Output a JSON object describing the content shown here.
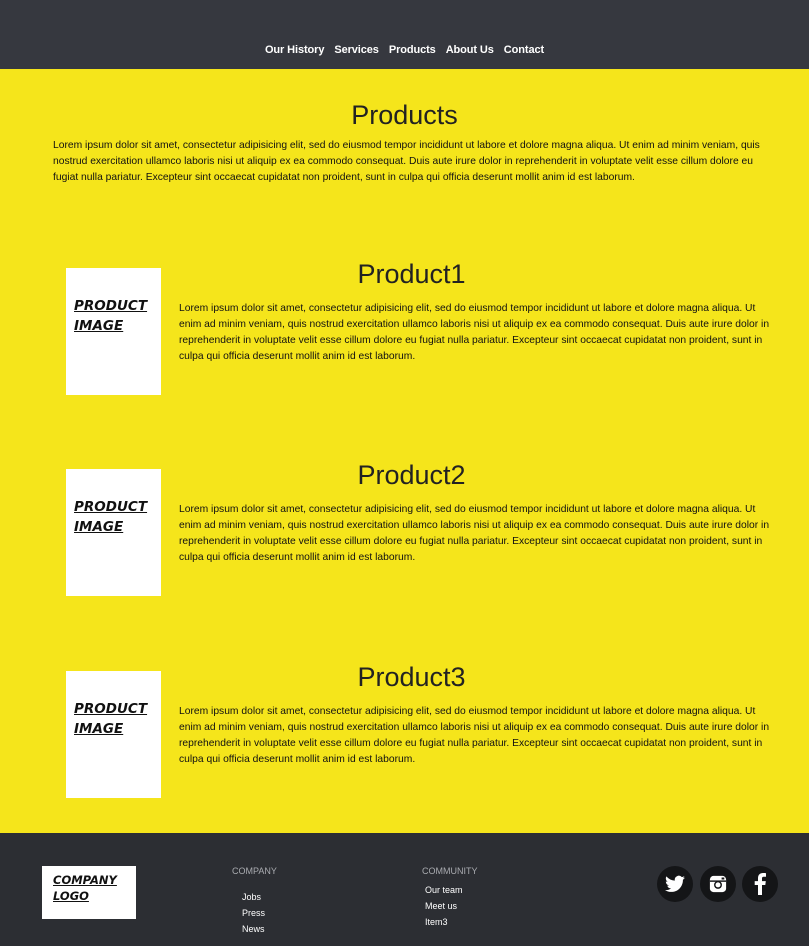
{
  "nav": {
    "items": [
      "Our History",
      "Services",
      "Products",
      "About Us",
      "Contact"
    ]
  },
  "main": {
    "title": "Products",
    "intro": "Lorem ipsum dolor sit amet, consectetur adipisicing elit, sed do eiusmod tempor incididunt ut labore et dolore magna aliqua. Ut enim ad minim veniam, quis nostrud exercitation ullamco laboris nisi ut aliquip ex ea commodo consequat. Duis aute irure dolor in reprehenderit in voluptate velit esse cillum dolore eu fugiat nulla pariatur. Excepteur sint occaecat cupidatat non proident, sunt in culpa qui officia deserunt mollit anim id est laborum."
  },
  "products": [
    {
      "name": "Product1",
      "image_label": "PRODUCT IMAGE",
      "description": "Lorem ipsum dolor sit amet, consectetur adipisicing elit, sed do eiusmod tempor incididunt ut labore et dolore magna aliqua. Ut enim ad minim veniam, quis nostrud exercitation ullamco laboris nisi ut aliquip ex ea commodo consequat. Duis aute irure dolor in reprehenderit in voluptate velit esse cillum dolore eu fugiat nulla pariatur. Excepteur sint occaecat cupidatat non proident, sunt in culpa qui officia deserunt mollit anim id est laborum."
    },
    {
      "name": "Product2",
      "image_label": "PRODUCT IMAGE",
      "description": "Lorem ipsum dolor sit amet, consectetur adipisicing elit, sed do eiusmod tempor incididunt ut labore et dolore magna aliqua. Ut enim ad minim veniam, quis nostrud exercitation ullamco laboris nisi ut aliquip ex ea commodo consequat. Duis aute irure dolor in reprehenderit in voluptate velit esse cillum dolore eu fugiat nulla pariatur. Excepteur sint occaecat cupidatat non proident, sunt in culpa qui officia deserunt mollit anim id est laborum."
    },
    {
      "name": "Product3",
      "image_label": "PRODUCT IMAGE",
      "description": "Lorem ipsum dolor sit amet, consectetur adipisicing elit, sed do eiusmod tempor incididunt ut labore et dolore magna aliqua. Ut enim ad minim veniam, quis nostrud exercitation ullamco laboris nisi ut aliquip ex ea commodo consequat. Duis aute irure dolor in reprehenderit in voluptate velit esse cillum dolore eu fugiat nulla pariatur. Excepteur sint occaecat cupidatat non proident, sunt in culpa qui officia deserunt mollit anim id est laborum."
    }
  ],
  "footer": {
    "logo": "COMPANY LOGO",
    "company": {
      "heading": "COMPANY",
      "links": [
        "Jobs",
        "Press",
        "News"
      ]
    },
    "community": {
      "heading": "COMMUNITY",
      "links": [
        "Our team",
        "Meet us",
        "Item3"
      ]
    },
    "social": [
      "twitter-icon",
      "instagram-icon",
      "facebook-icon"
    ]
  },
  "colors": {
    "nav_bg": "#36383f",
    "main_bg": "#f5e51b",
    "footer_bg": "#2c2e33",
    "social_bg": "#141517"
  }
}
